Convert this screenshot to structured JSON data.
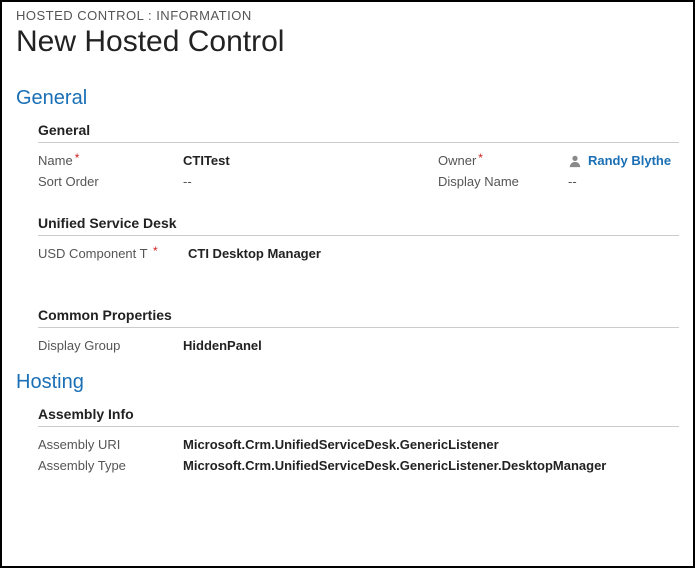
{
  "breadcrumb": "HOSTED CONTROL : INFORMATION",
  "pageTitle": "New Hosted Control",
  "sections": {
    "general": {
      "header": "General",
      "sub_general": {
        "header": "General",
        "name_label": "Name",
        "name_value": "CTITest",
        "owner_label": "Owner",
        "owner_value": "Randy Blythe",
        "sort_label": "Sort Order",
        "sort_value": "--",
        "display_name_label": "Display Name",
        "display_name_value": "--"
      },
      "sub_usd": {
        "header": "Unified Service Desk",
        "comp_label": "USD Component T",
        "comp_value": "CTI Desktop Manager"
      },
      "sub_common": {
        "header": "Common Properties",
        "group_label": "Display Group",
        "group_value": "HiddenPanel"
      }
    },
    "hosting": {
      "header": "Hosting",
      "sub_assembly": {
        "header": "Assembly Info",
        "uri_label": "Assembly URI",
        "uri_value": "Microsoft.Crm.UnifiedServiceDesk.GenericListener",
        "type_label": "Assembly Type",
        "type_value": "Microsoft.Crm.UnifiedServiceDesk.GenericListener.DesktopManager"
      }
    }
  }
}
